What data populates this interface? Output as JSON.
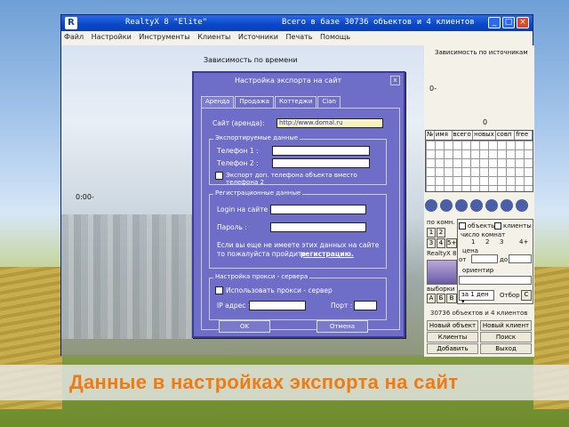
{
  "window": {
    "app_title": "RealtyX 8 \"Elite\"",
    "db_status": "Всего в базе 30736 объектов и 4 клиентов",
    "minimize": "_",
    "maximize": "□",
    "close": "×"
  },
  "menu": [
    "Файл",
    "Настройки",
    "Инструменты",
    "Клиенты",
    "Источники",
    "Печать",
    "Помощь"
  ],
  "charts": {
    "time_title": "Зависимость по времени",
    "time_axis_label": "0:00-",
    "sources_title": "Зависимость по источникам",
    "sources_y_label": "0-",
    "sources_x_label": "0"
  },
  "grid": {
    "columns": [
      "№",
      "имя",
      "всего",
      "новых",
      "совп",
      "free"
    ]
  },
  "right_panel": {
    "label_rooms": "по комн.",
    "rooms": [
      "1",
      "2",
      "3",
      "4",
      "5+"
    ],
    "realty_label": "RealtyX 8",
    "selections_label": "выборки",
    "letters": [
      "А",
      "Б",
      "В"
    ],
    "objects_check": "объекты",
    "clients_check": "клиенты",
    "rooms_count": "число комнат",
    "room_opts": [
      "1",
      "2",
      "3",
      "4+"
    ],
    "price_label": "цена",
    "from": "от",
    "to": "до",
    "landmark": "ориентир",
    "period": "за 1 ден",
    "select_label": "Отбор",
    "reset": "С",
    "summary": "30736 объектов и 4 клиентов",
    "buttons": [
      "Новый объект",
      "Новый клиент",
      "Клиенты",
      "Поиск",
      "Добавить",
      "Выход"
    ]
  },
  "dialog": {
    "title": "Настройка экспорта на сайт",
    "close": "x",
    "tabs": [
      "Аренда",
      "Продажа",
      "Коттеджи",
      "Cian"
    ],
    "site_label": "Сайт (аренда):",
    "site_value": "http://www.domal.ru",
    "exported_group": "Экспортируемые данные",
    "phone1": "Телефон 1 :",
    "phone2": "Телефон 2 :",
    "export_extra_phone": "Экспорт доп. телефона объекта вместо телефона 2",
    "reg_group": "Регистрационные данные",
    "login": "Login на сайте :",
    "password": "Пароль :",
    "reg_note_line1": "Если вы еще не имеете этих данных на сайте",
    "reg_note_line2": "то пожалуйста  пройдите",
    "reg_link": "регистрацию.",
    "proxy_group": "Настройка прокси - сервера",
    "use_proxy": "Использовать прокси - сервер",
    "ip_label": "IP адрес :",
    "port_label": "Порт :",
    "ok": "OK",
    "cancel": "Отмена"
  },
  "caption": "Данные в настройках экспорта на сайт"
}
